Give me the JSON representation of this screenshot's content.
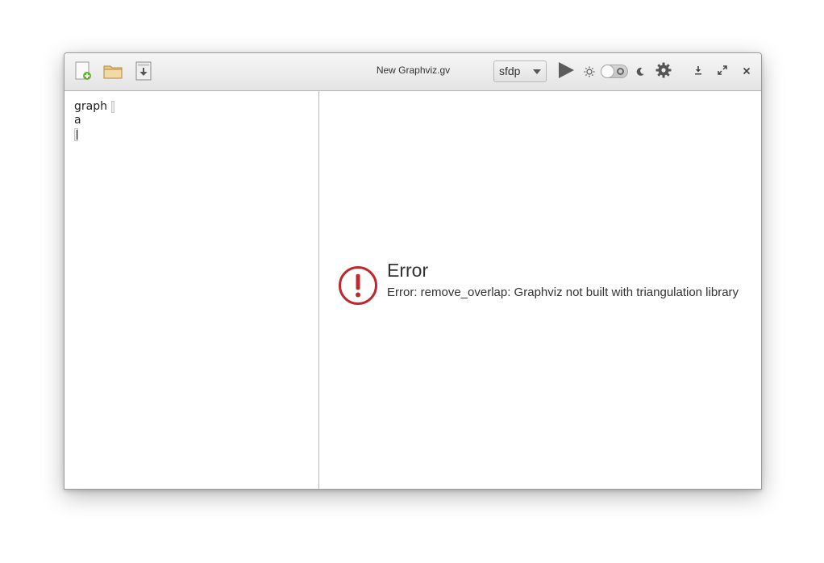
{
  "window": {
    "title": "New Graphviz.gv"
  },
  "toolbar": {
    "new_file_icon": "new-document-icon",
    "open_icon": "folder-open-icon",
    "save_icon": "save-download-icon",
    "layout_engine": {
      "selected": "sfdp"
    },
    "run_icon": "play-icon",
    "light_icon": "sun-icon",
    "dark_icon": "moon-icon",
    "dark_mode_enabled": false,
    "settings_icon": "gear-icon"
  },
  "window_controls": {
    "minimize_icon": "minimize-icon",
    "maximize_icon": "maximize-icon",
    "close_icon": "close-icon"
  },
  "editor": {
    "lines": [
      "graph",
      "a",
      ""
    ]
  },
  "preview": {
    "error_title": "Error",
    "error_message": "Error: remove_overlap: Graphviz not built with triangulation library"
  },
  "colors": {
    "error_red": "#c0282d",
    "accent_green": "#5db62b"
  }
}
